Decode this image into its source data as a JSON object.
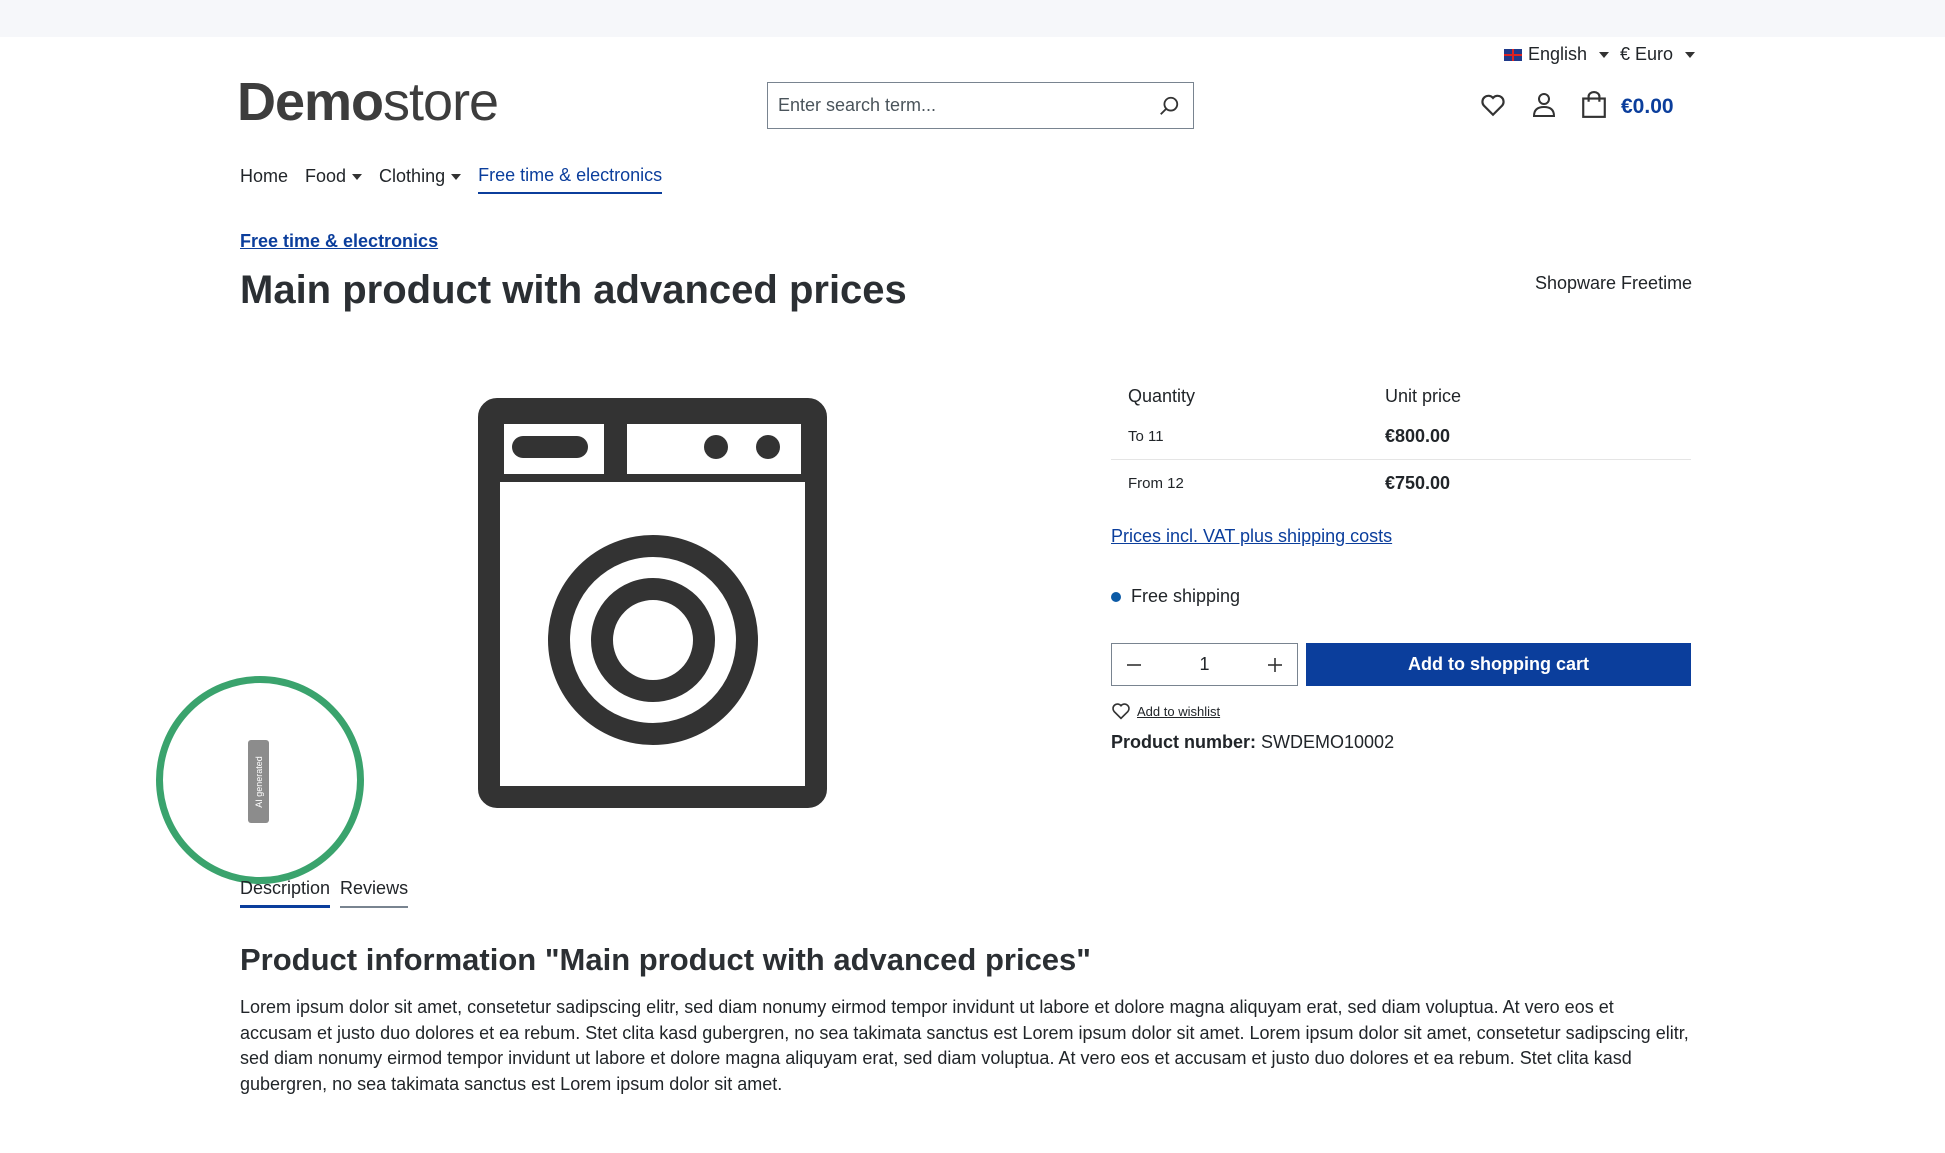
{
  "header": {
    "language": "English",
    "currency": "€ Euro",
    "logo": {
      "bold": "Demo",
      "light": "store"
    },
    "search": {
      "placeholder": "Enter search term..."
    },
    "cart_total": "€0.00"
  },
  "nav": {
    "items": [
      {
        "label": "Home",
        "dropdown": false
      },
      {
        "label": "Food",
        "dropdown": true
      },
      {
        "label": "Clothing",
        "dropdown": true
      },
      {
        "label": "Free time & electronics",
        "dropdown": false,
        "active": true
      }
    ]
  },
  "product": {
    "breadcrumb": "Free time & electronics",
    "title": "Main product with advanced prices",
    "manufacturer": "Shopware Freetime",
    "image_icon": "washing-machine-icon",
    "ai_badge": "AI generated",
    "price_table": {
      "headers": [
        "Quantity",
        "Unit price"
      ],
      "rows": [
        {
          "quantity": "To 11",
          "price": "€800.00"
        },
        {
          "quantity": "From 12",
          "price": "€750.00"
        }
      ]
    },
    "vat_link": "Prices incl. VAT plus shipping costs",
    "delivery": "Free shipping",
    "quantity": "1",
    "add_to_cart": "Add to shopping cart",
    "wishlist": "Add to wishlist",
    "product_number_label": "Product number:",
    "product_number": "SWDEMO10002"
  },
  "tabs": {
    "items": [
      {
        "label": "Description",
        "active": true
      },
      {
        "label": "Reviews",
        "active": false
      }
    ]
  },
  "description": {
    "title": "Product information \"Main product with advanced prices\"",
    "text": "Lorem ipsum dolor sit amet, consetetur sadipscing elitr, sed diam nonumy eirmod tempor invidunt ut labore et dolore magna aliquyam erat, sed diam voluptua. At vero eos et accusam et justo duo dolores et ea rebum. Stet clita kasd gubergren, no sea takimata sanctus est Lorem ipsum dolor sit amet. Lorem ipsum dolor sit amet, consetetur sadipscing elitr, sed diam nonumy eirmod tempor invidunt ut labore et dolore magna aliquyam erat, sed diam voluptua. At vero eos et accusam et justo duo dolores et ea rebum. Stet clita kasd gubergren, no sea takimata sanctus est Lorem ipsum dolor sit amet."
  },
  "colors": {
    "primary": "#0b3e9c",
    "ai_ring": "#3aa36d",
    "delivery_dot": "#0b5aa6"
  }
}
